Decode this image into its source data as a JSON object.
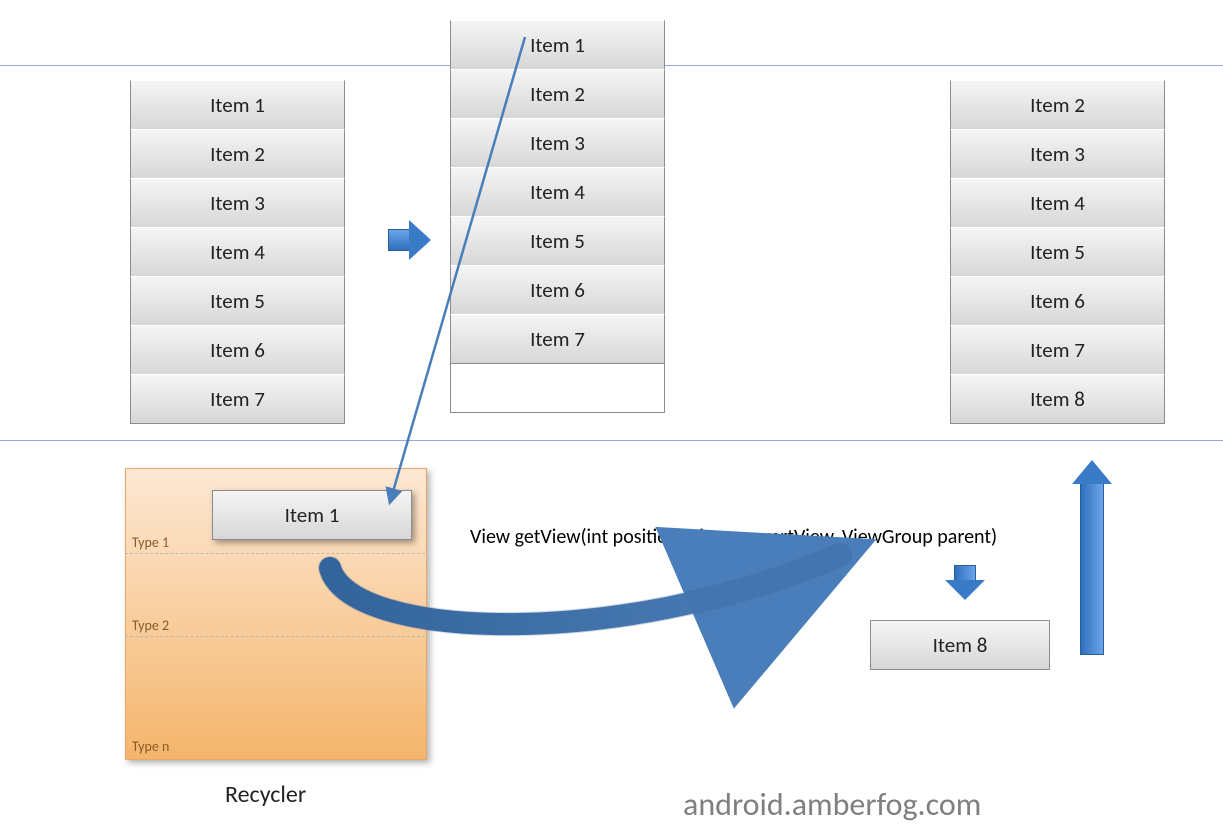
{
  "lists": {
    "left": [
      "Item 1",
      "Item 2",
      "Item 3",
      "Item 4",
      "Item 5",
      "Item 6",
      "Item 7"
    ],
    "middle": [
      "Item 1",
      "Item 2",
      "Item 3",
      "Item 4",
      "Item 5",
      "Item 6",
      "Item 7"
    ],
    "right": [
      "Item 2",
      "Item 3",
      "Item 4",
      "Item 5",
      "Item 6",
      "Item 7",
      "Item 8"
    ]
  },
  "recycler": {
    "item_in_bin": "Item 1",
    "types": {
      "t1": "Type 1",
      "t2": "Type 2",
      "tn": "Type n"
    },
    "caption": "Recycler"
  },
  "new_item": "Item 8",
  "method_signature": "View getView(int position, View convertView, ViewGroup parent)",
  "footer": "android.amberfog.com"
}
